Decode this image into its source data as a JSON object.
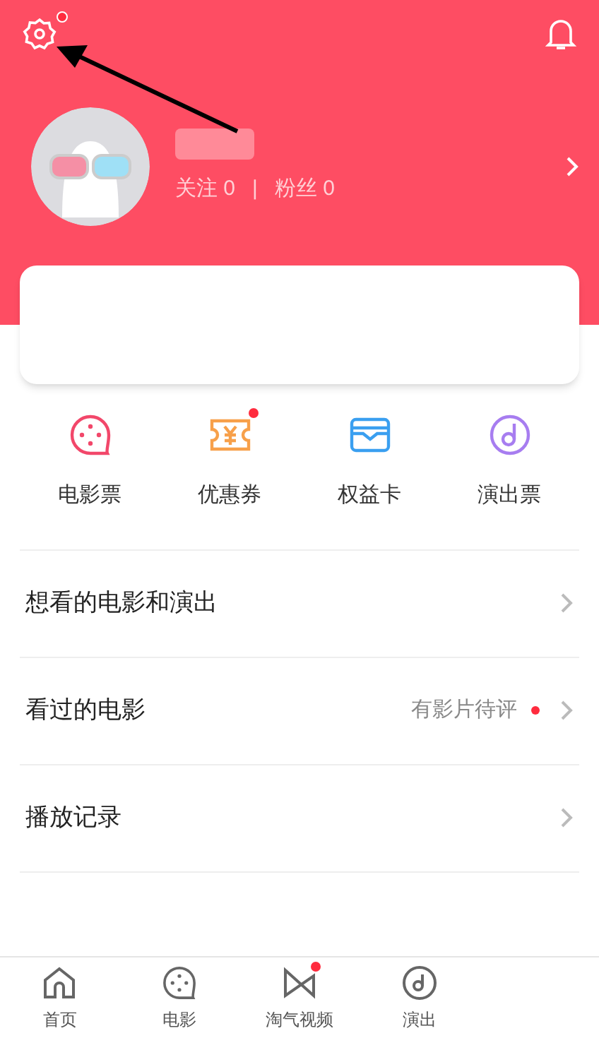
{
  "header": {
    "settings_badge": true,
    "stats": [
      {
        "label": "关注",
        "value": "0"
      },
      {
        "label": "粉丝",
        "value": "0"
      }
    ],
    "divider": "|"
  },
  "shortcuts": [
    {
      "kind": "film",
      "label": "电影票",
      "badge": false
    },
    {
      "kind": "coupon",
      "label": "优惠券",
      "badge": true
    },
    {
      "kind": "card",
      "label": "权益卡",
      "badge": false
    },
    {
      "kind": "music",
      "label": "演出票",
      "badge": false
    }
  ],
  "menu": [
    {
      "label": "想看的电影和演出",
      "dot": false
    },
    {
      "label": "看过的电影",
      "note": "有影片待评",
      "dot": true
    },
    {
      "label": "播放记录",
      "dot": false
    }
  ],
  "tabbar": [
    {
      "kind": "home",
      "label": "首页",
      "badge": false
    },
    {
      "kind": "film",
      "label": "电影",
      "badge": false
    },
    {
      "kind": "video",
      "label": "淘气视频",
      "badge": true
    },
    {
      "kind": "show",
      "label": "演出",
      "badge": false
    }
  ]
}
